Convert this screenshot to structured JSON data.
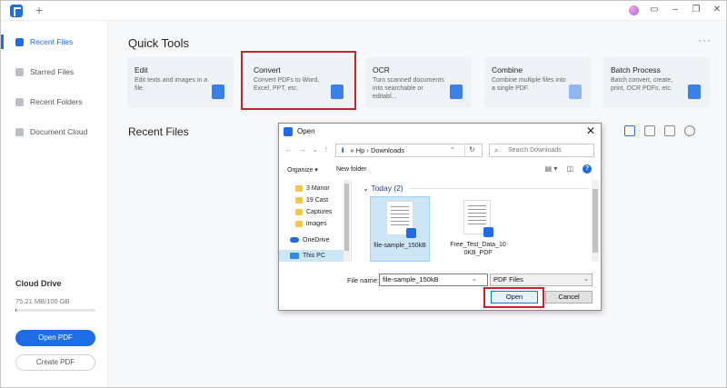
{
  "titlebar": {
    "new_tab": "+",
    "icons": [
      "avatar-icon",
      "message-icon",
      "minimize-icon",
      "restore-icon",
      "close-icon"
    ]
  },
  "sidebar": {
    "items": [
      {
        "label": "Recent Files",
        "icon": "recent-files-icon",
        "active": true
      },
      {
        "label": "Starred Files",
        "icon": "star-icon",
        "active": false
      },
      {
        "label": "Recent Folders",
        "icon": "folder-icon",
        "active": false
      },
      {
        "label": "Document Cloud",
        "icon": "cloud-icon",
        "active": false
      }
    ],
    "cloud_drive": {
      "title": "Cloud Drive",
      "usage": "75.21 MB/100 GB",
      "usage_fraction": 0.0007
    },
    "open_pdf": "Open PDF",
    "create_pdf": "Create PDF"
  },
  "main": {
    "quick_tools_title": "Quick Tools",
    "more": "···",
    "tools": [
      {
        "title": "Edit",
        "desc": "Edit texts and images in a file."
      },
      {
        "title": "Convert",
        "desc": "Convert PDFs to Word, Excel, PPT, etc."
      },
      {
        "title": "OCR",
        "desc": "Turn scanned documents into searchable or editabl..."
      },
      {
        "title": "Combine",
        "desc": "Combine multiple files into a single PDF."
      },
      {
        "title": "Batch Process",
        "desc": "Batch convert, create, print, OCR PDFs, etc."
      }
    ],
    "recent_files_title": "Recent Files"
  },
  "dialog": {
    "title": "Open",
    "close": "✕",
    "path": {
      "prefix": "«",
      "segments": [
        "Hp",
        "Downloads"
      ],
      "separator": "›"
    },
    "search_placeholder": "Search Downloads",
    "organize": "Organize ▾",
    "new_folder": "New folder",
    "nav": [
      {
        "label": "3 Manor",
        "type": "folder"
      },
      {
        "label": "19 Cast",
        "type": "folder"
      },
      {
        "label": "Captures",
        "type": "folder"
      },
      {
        "label": "images",
        "type": "folder"
      },
      {
        "label": "OneDrive",
        "type": "cloud"
      },
      {
        "label": "This PC",
        "type": "pc",
        "selected": true
      }
    ],
    "group_header": "⌄ Today (2)",
    "files": [
      {
        "name": "file-sample_150kB",
        "selected": true
      },
      {
        "name": "Free_Test_Data_100KB_PDF",
        "selected": false
      }
    ],
    "file_name_label": "File name:",
    "file_name_value": "file-sample_150kB",
    "file_type": "PDF Files",
    "open_button": "Open",
    "cancel_button": "Cancel"
  },
  "colors": {
    "accent": "#1e6ce6",
    "highlight": "#c8232c"
  }
}
